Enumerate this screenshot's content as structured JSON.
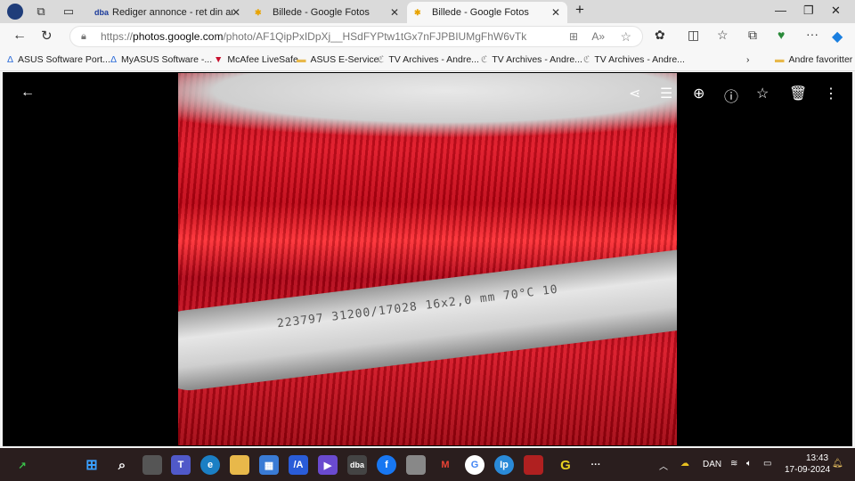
{
  "tabs": [
    {
      "label": "Rediger annonce - ret din annonce",
      "favicon": "dba"
    },
    {
      "label": "Billede - Google Fotos"
    },
    {
      "label": "Billede - Google Fotos",
      "active": true
    }
  ],
  "address": {
    "prefix": "https://",
    "domain": "photos.google.com",
    "path": "/photo/AF1QipPxIDpXj__HSdFYPtw1tGx7nFJPBIUMgFhW6vTk"
  },
  "bookmarks": [
    "ASUS Software Port...",
    "MyASUS Software -...",
    "McAfee LiveSafe",
    "ASUS E-Service",
    "TV Archives - Andre...",
    "TV Archives - Andre...",
    "TV Archives - Andre..."
  ],
  "other_favorites": "Andre favoritter",
  "photo": {
    "printed_text": "223797 31200/17028   16x2,0 mm   70°C  10"
  },
  "taskbar": {
    "dba": "dba",
    "language": "DAN",
    "time": "13:43",
    "date": "17-09-2024"
  }
}
